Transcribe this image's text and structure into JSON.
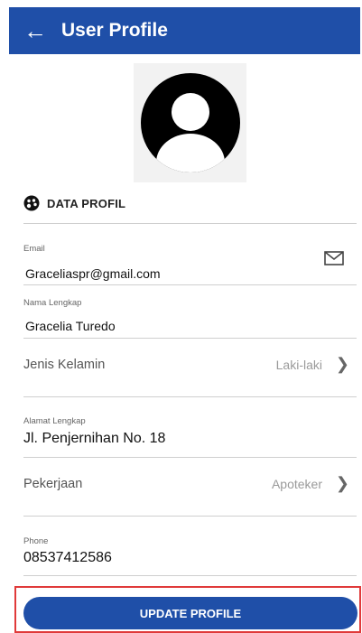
{
  "header": {
    "title": "User Profile",
    "back_icon": "arrow-left-icon"
  },
  "section": {
    "title": "DATA PROFIL",
    "icon": "palette-icon"
  },
  "fields": {
    "email": {
      "label": "Email",
      "value": "Graceliaspr@gmail.com",
      "icon": "mail-icon"
    },
    "name": {
      "label": "Nama Lengkap",
      "value": "Gracelia Turedo"
    },
    "gender": {
      "label": "Jenis Kelamin",
      "value": "Laki-laki"
    },
    "address": {
      "label": "Alamat Lengkap",
      "value": "Jl. Penjernihan No. 18"
    },
    "job": {
      "label": "Pekerjaan",
      "value": "Apoteker"
    },
    "phone": {
      "label": "Phone",
      "value": "08537412586"
    }
  },
  "actions": {
    "update_label": "UPDATE PROFILE"
  },
  "colors": {
    "primary": "#1f4fa8",
    "highlight": "#e03a3a"
  }
}
